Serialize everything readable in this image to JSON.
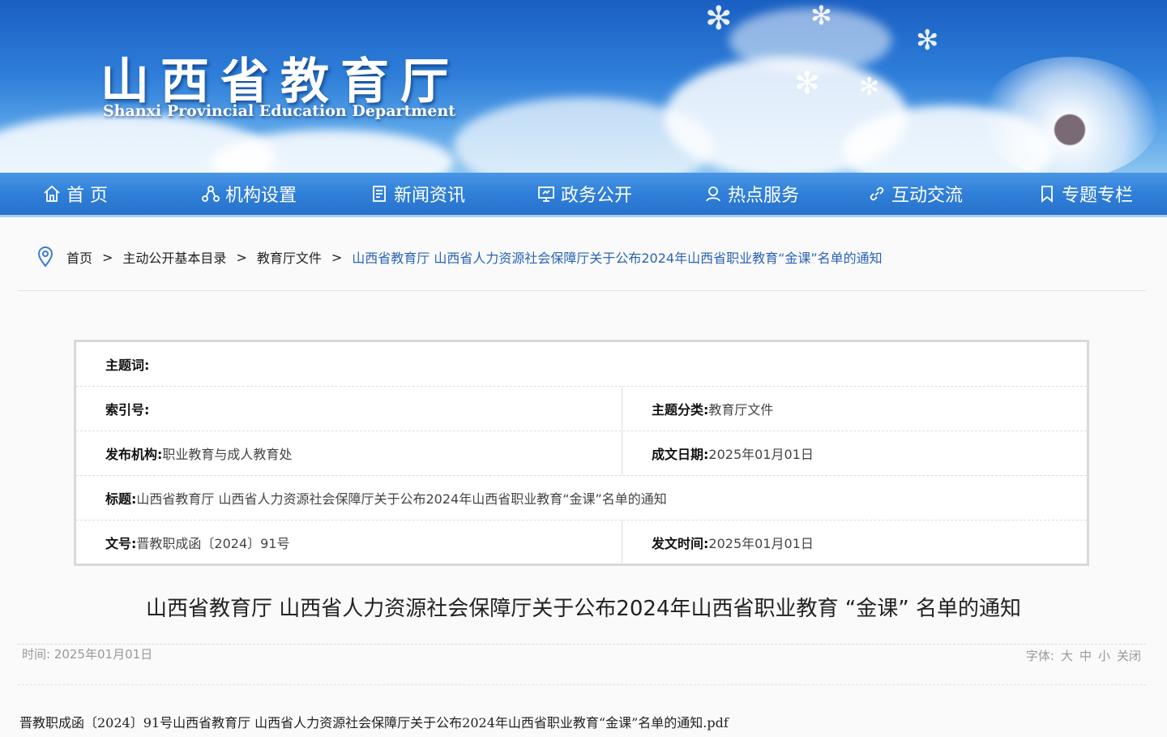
{
  "banner": {
    "title": "山西省教育厅",
    "subtitle": "Shanxi Provincial Education Department"
  },
  "nav": {
    "items": [
      {
        "label": "首 页",
        "icon": "home-icon"
      },
      {
        "label": "机构设置",
        "icon": "org-icon"
      },
      {
        "label": "新闻资讯",
        "icon": "news-icon"
      },
      {
        "label": "政务公开",
        "icon": "gov-icon"
      },
      {
        "label": "热点服务",
        "icon": "service-icon"
      },
      {
        "label": "互动交流",
        "icon": "link-icon"
      },
      {
        "label": "专题专栏",
        "icon": "bookmark-icon"
      }
    ]
  },
  "breadcrumb": {
    "items": [
      "首页",
      "主动公开基本目录",
      "教育厅文件"
    ],
    "separator": ">",
    "current": "山西省教育厅 山西省人力资源社会保障厅关于公布2024年山西省职业教育“金课”名单的通知"
  },
  "info": {
    "keywords_label": "主题词:",
    "keywords_value": "",
    "index_label": "索引号:",
    "index_value": "",
    "category_label": "主题分类:",
    "category_value": "教育厅文件",
    "publisher_label": "发布机构:",
    "publisher_value": "职业教育与成人教育处",
    "date_label": "成文日期:",
    "date_value": "2025年01月01日",
    "title_label": "标题:",
    "title_value": "山西省教育厅 山西省人力资源社会保障厅关于公布2024年山西省职业教育“金课”名单的通知",
    "docno_label": "文号:",
    "docno_value": "晋教职成函〔2024〕91号",
    "pubtime_label": "发文时间:",
    "pubtime_value": "2025年01月01日"
  },
  "article": {
    "title": "山西省教育厅 山西省人力资源社会保障厅关于公布2024年山西省职业教育 “金课” 名单的通知",
    "time_label": "时间:",
    "time_value": "2025年01月01日",
    "font_label": "字体:",
    "font_large": "大",
    "font_medium": "中",
    "font_small": "小",
    "close": "关闭",
    "attachment": "晋教职成函〔2024〕91号山西省教育厅 山西省人力资源社会保障厅关于公布2024年山西省职业教育“金课”名单的通知.pdf"
  }
}
